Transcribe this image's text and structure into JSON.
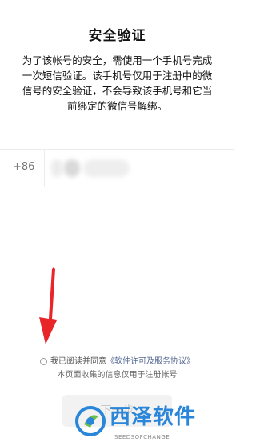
{
  "header": {
    "title": "安全验证"
  },
  "description": {
    "line1": "为了该帐号的安全，需使用一个手机号完成",
    "line2": "一次短信验证。该手机号仅用于注册中的微",
    "line3": "信号的安全验证，不会导致该手机号和它当",
    "line4": "前绑定的微信号解绑。"
  },
  "phone": {
    "country_code": "+86",
    "value": "",
    "placeholder": ""
  },
  "agreement": {
    "prefix": "我已阅读并同意",
    "link_text": "《软件许可及服务协议》",
    "checked": false
  },
  "notice": {
    "text": "本页面收集的信息仅用于注册帐号"
  },
  "next_button": {
    "label": "下一步"
  },
  "watermark": {
    "text": "西泽软件",
    "sub": "SEEDSOFCHANGE"
  },
  "colors": {
    "link": "#576b95",
    "annotation_arrow": "#e8262a",
    "watermark_blue": "#2a86d9",
    "watermark_green": "#6cc04a"
  },
  "icons": {
    "annotation": "red-arrow-icon",
    "checkbox": "radio-circle-icon",
    "logo": "brand-logo-icon"
  }
}
